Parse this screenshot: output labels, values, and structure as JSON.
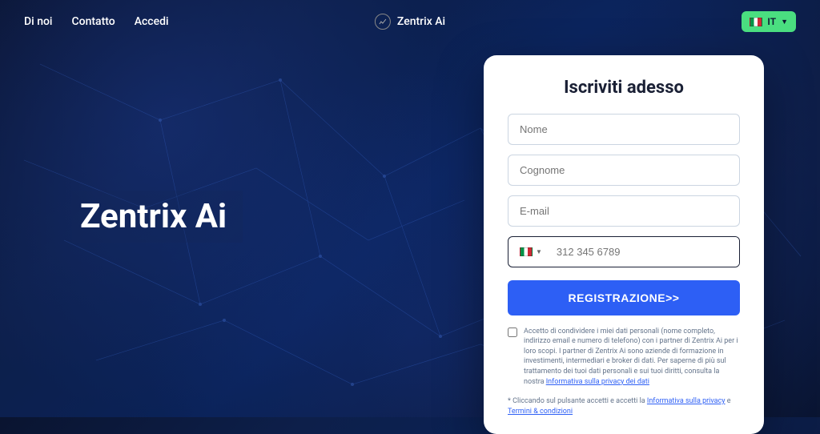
{
  "nav": {
    "about": "Di noi",
    "contact": "Contatto",
    "login": "Accedi"
  },
  "brand": {
    "name": "Zentrix Ai"
  },
  "lang": {
    "label": "IT"
  },
  "hero": {
    "title": "Zentrix Ai"
  },
  "form": {
    "title": "Iscriviti adesso",
    "first_name_placeholder": "Nome",
    "last_name_placeholder": "Cognome",
    "email_placeholder": "E-mail",
    "phone_placeholder": "312 345 6789",
    "submit_label": "REGISTRAZIONE>>",
    "consent_text": "Accetto di condividere i miei dati personali (nome completo, indirizzo email e numero di telefono) con i partner di Zentrix Ai per i loro scopi. I partner di Zentrix Ai sono aziende di formazione in investimenti, intermediari e broker di dati. Per saperne di più sul trattamento dei tuoi dati personali e sui tuoi diritti, consulta la nostra ",
    "consent_link": "Informativa sulla privacy dei dati",
    "footnote_prefix": "* Cliccando sul pulsante accetti e accetti la ",
    "footnote_privacy": "Informativa sulla privacy",
    "footnote_and": " e ",
    "footnote_terms": "Termini & condizioni"
  }
}
